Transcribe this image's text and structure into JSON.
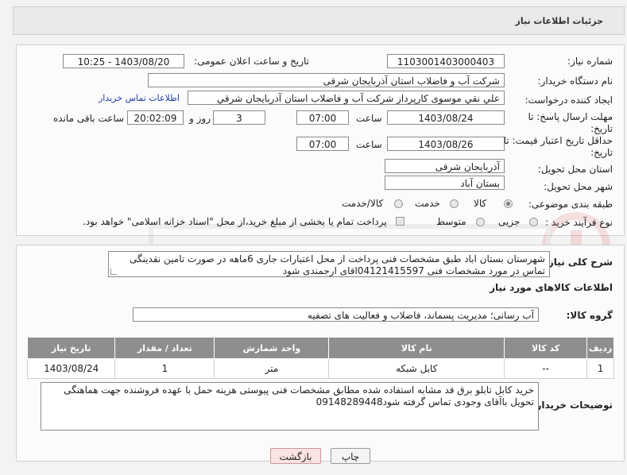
{
  "header": {
    "title": "جزئیات اطلاعات نیاز"
  },
  "form": {
    "need_number": {
      "label": "شماره نیاز:",
      "value": "1103001403000403"
    },
    "announce": {
      "label": "تاریخ و ساعت اعلان عمومی:",
      "value": "1403/08/20 - 10:25"
    },
    "buyer_org": {
      "label": "نام دستگاه خریدار:",
      "value": "شرکت آب و فاضلاب استان آذربایجان شرقی"
    },
    "requester": {
      "label": "ایجاد کننده درخواست:",
      "value": "علي نقي موسوی کارپرداز شرکت آب و فاضلاب استان آذربایجان شرقي",
      "contact_link": "اطلاعات تماس خریدار"
    },
    "reply_deadline": {
      "label1": "مهلت ارسال پاسخ: تا",
      "label2": "تاریخ:",
      "date": "1403/08/24",
      "time_label": "ساعت",
      "time": "07:00",
      "days": "3",
      "days_label": "روز و",
      "remaining": "20:02:09",
      "remaining_label": "ساعت باقی مانده"
    },
    "price_validity": {
      "label1": "حداقل تاریخ اعتبار قیمت: تا",
      "label2": "تاریخ:",
      "date": "1403/08/26",
      "time_label": "ساعت",
      "time": "07:00"
    },
    "delivery_province": {
      "label": "استان محل تحویل:",
      "value": "آذربایجان شرقی"
    },
    "delivery_city": {
      "label": "شهر محل تحویل:",
      "value": "بستان آباد"
    },
    "category": {
      "label": "طبقه بندی موضوعی:",
      "options": [
        "کالا",
        "خدمت",
        "کالا/خدمت"
      ],
      "selected": "کالا"
    },
    "process": {
      "label": "نوع فرآیند خرید :",
      "options": [
        "جزیی",
        "متوسط"
      ],
      "payment_note": "پرداخت تمام یا بخشی از مبلغ خرید،از محل \"اسناد خزانه اسلامی\" خواهد بود."
    }
  },
  "summary": {
    "label": "شرح کلی نیاز:",
    "text": "شهرستان بستان اباد  طبق مشخصات فنی پرداخت از محل اعتبارات جاری  6ماهه در صورت تامین نقدینگی تماس در مورد مشخصات فنی 04121415597اقای  ارجمندی  شود"
  },
  "goods": {
    "section_title": "اطلاعات کالاهای مورد نیاز",
    "group_label": "گروه کالا:",
    "group_value": "آب رسانی؛ مدیریت پسماند، فاضلاب و فعالیت های تصفیه",
    "columns": [
      "ردیف",
      "کد کالا",
      "نام کالا",
      "واحد شمارش",
      "تعداد / مقدار",
      "تاریخ نیاز"
    ],
    "rows": [
      {
        "row": "1",
        "code": "--",
        "name": "کابل شبکه",
        "unit": "متر",
        "qty": "1",
        "date": "1403/08/24"
      }
    ]
  },
  "buyer_notes": {
    "label": "توضیحات خریدار:",
    "text": "خرید کابل تابلو برق  قد مشابه استفاده شده مطابق مشخصات فنی پیوستی  هزینه حمل با عهده فروشنده جهت هماهنگی تحویل باآقای وجودی  تماس گرفته شود09148289448"
  },
  "buttons": {
    "back": "بازگشت",
    "print": "چاپ"
  },
  "colors": {
    "link": "#1f3ea8",
    "table_header": "#8e8e8e",
    "back_button": "#fbe3e3"
  }
}
